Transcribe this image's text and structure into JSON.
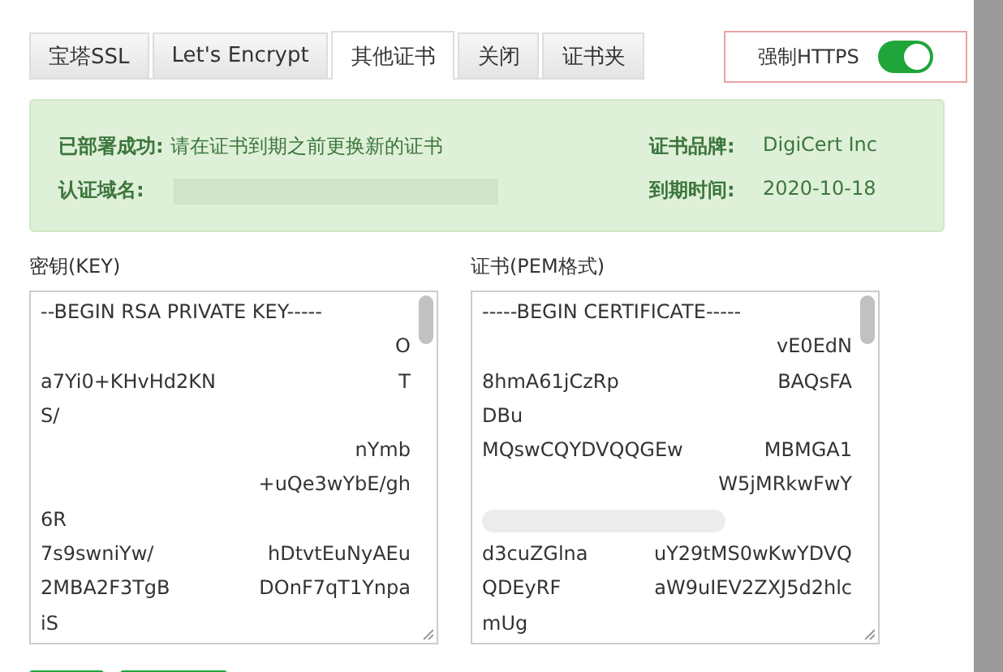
{
  "tabs": [
    {
      "label": "宝塔SSL",
      "selected": false
    },
    {
      "label": "Let's Encrypt",
      "selected": false
    },
    {
      "label": "其他证书",
      "selected": true
    },
    {
      "label": "关闭",
      "selected": false
    },
    {
      "label": "证书夹",
      "selected": false
    }
  ],
  "force_https": {
    "label": "强制HTTPS",
    "on": true
  },
  "status": {
    "deployed_label": "已部署成功:",
    "deployed_text": "请在证书到期之前更换新的证书",
    "domain_label": "认证域名:",
    "brand_label": "证书品牌:",
    "brand": "DigiCert Inc",
    "expiry_label": "到期时间:",
    "expiry": "2020-10-18"
  },
  "key": {
    "label": "密钥(KEY)",
    "lines": [
      {
        "left": "--BEGIN RSA PRIVATE KEY-----"
      },
      {
        "right": "O"
      },
      {
        "left": "a7Yi0+KHvHd2KN",
        "right": "T"
      },
      {
        "left": "S/"
      },
      {
        "right": "nYmb"
      },
      {
        "right": "+uQe3wYbE/gh"
      },
      {
        "left": "6R"
      },
      {
        "left": "7s9swniYw/",
        "right": "hDtvtEuNyAEu"
      },
      {
        "left": "2MBA2F3TgB",
        "right": "DOnF7qT1Ynpa"
      },
      {
        "left": "iS"
      }
    ]
  },
  "certificate": {
    "label": "证书(PEM格式)",
    "lines": [
      {
        "left": "-----BEGIN CERTIFICATE-----"
      },
      {
        "right": "vE0EdN"
      },
      {
        "left": "8hmA61jCzRp",
        "right": "BAQsFA"
      },
      {
        "left": "DBu"
      },
      {
        "left": "MQswCQYDVQQGEw",
        "right": "MBMGA1"
      },
      {
        "right": "W5jMRkwFwY"
      },
      {
        "kind": "redacted"
      },
      {
        "left": "d3cuZGlna",
        "right": "uY29tMS0wKwYDVQ"
      },
      {
        "left": "QDEyRF",
        "right": "aW9uIEV2ZXJ5d2hlc"
      },
      {
        "left": "mUg"
      }
    ]
  }
}
